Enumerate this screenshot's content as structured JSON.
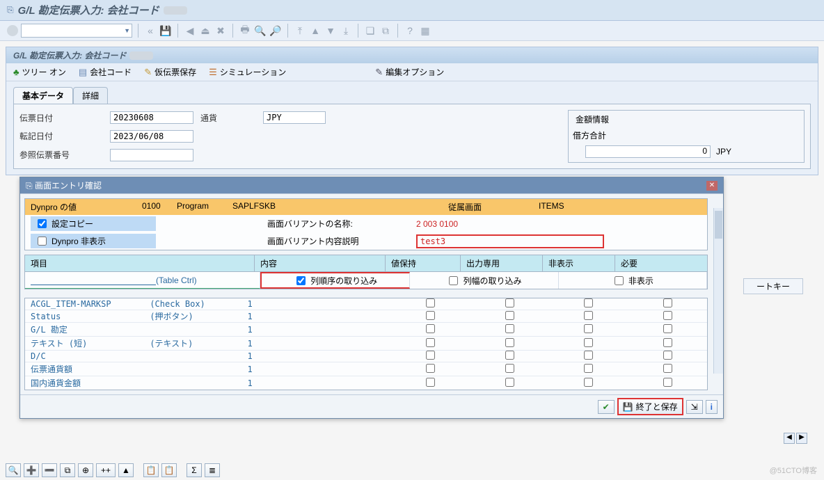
{
  "window": {
    "title": "G/L 勘定伝票入力: 会社コード"
  },
  "toolbar_icons": [
    "save-icon",
    "back-icon",
    "forward-icon",
    "cancel-icon",
    "print-icon",
    "find-icon",
    "find-next-icon",
    "first-page-icon",
    "prev-page-icon",
    "next-page-icon",
    "last-page-icon",
    "new-session-icon",
    "layout-icon",
    "help-icon",
    "settings-icon"
  ],
  "inner": {
    "title": "G/L 勘定伝票入力: 会社コード"
  },
  "appbar": {
    "tree_on": "ツリー オン",
    "company": "会社コード",
    "park": "仮伝票保存",
    "simulate": "シミュレーション",
    "edit_opts": "編集オプション"
  },
  "tabs": {
    "basic": "基本データ",
    "detail": "詳細"
  },
  "form": {
    "doc_date_l": "伝票日付",
    "doc_date_v": "20230608",
    "currency_l": "通貨",
    "currency_v": "JPY",
    "post_date_l": "転記日付",
    "post_date_v": "2023/06/08",
    "ref_l": "参照伝票番号"
  },
  "amount_box": {
    "title": "金額情報",
    "debit_l": "借方合計",
    "debit_v": "0",
    "curr": "JPY"
  },
  "right_column_header": "ートキー",
  "dialog": {
    "title": "画面エントリ確認",
    "dynpro_label": "Dynpro の値",
    "prog_no": "0100",
    "prog_l": "Program",
    "prog_v": "SAPLFSKB",
    "subord_l": "従属画面",
    "subord_v": "ITEMS",
    "copy_settings": "設定コピー",
    "hide_dynpro": "Dynpro 非表示",
    "variant_name_l": "画面バリアントの名称:",
    "variant_name_v": "2     003 0100",
    "variant_desc_l": "画面バリアント内容説明",
    "variant_desc_v": "test3",
    "cols": {
      "item": "項目",
      "content": "内容",
      "keep": "値保持",
      "output_only": "出力専用",
      "hide": "非表示",
      "required": "必要"
    },
    "table_ctrl_l": "(Table Ctrl)",
    "opt_col_order": "列順序の取り込み",
    "opt_col_width": "列幅の取り込み",
    "opt_hide": "非表示",
    "items": [
      {
        "name": "ACGL_ITEM-MARKSP",
        "type": "(Check Box)",
        "w": "1"
      },
      {
        "name": "Status",
        "type": "(押ボタン)",
        "w": "1"
      },
      {
        "name": "G/L 勘定",
        "type": "",
        "w": "1"
      },
      {
        "name": "テキスト (短)",
        "type": "(テキスト)",
        "w": "1"
      },
      {
        "name": "D/C",
        "type": "",
        "w": "1"
      },
      {
        "name": "伝票通貨額",
        "type": "",
        "w": "1"
      },
      {
        "name": "国内通貨金額",
        "type": "",
        "w": "1"
      }
    ],
    "exit_save": "終了と保存"
  },
  "watermark": "@51CTO博客"
}
